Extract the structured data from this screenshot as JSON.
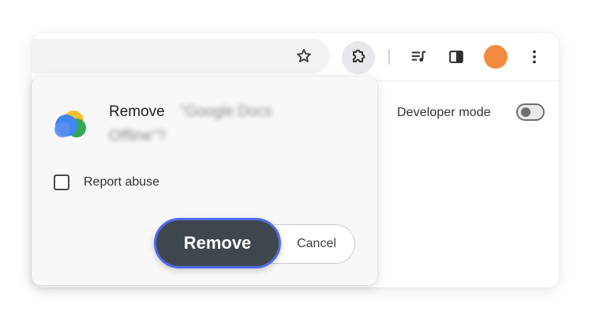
{
  "toolbar": {
    "icons": [
      "star-icon",
      "puzzle-icon",
      "media-control-icon",
      "side-panel-icon",
      "avatar",
      "more-vert-icon"
    ]
  },
  "page": {
    "developer_mode_label": "Developer mode",
    "developer_mode_on": false
  },
  "dialog": {
    "title_prefix": "Remove",
    "title_name_line1": "\"Google Docs",
    "title_name_line2": "Offline\"?",
    "report_abuse_label": "Report abuse",
    "report_abuse_checked": false,
    "remove_label": "Remove",
    "cancel_label": "Cancel"
  },
  "colors": {
    "remove_button_bg": "#3f474e",
    "remove_button_focus_ring": "#4f6af0",
    "avatar": "#f28b3f"
  }
}
